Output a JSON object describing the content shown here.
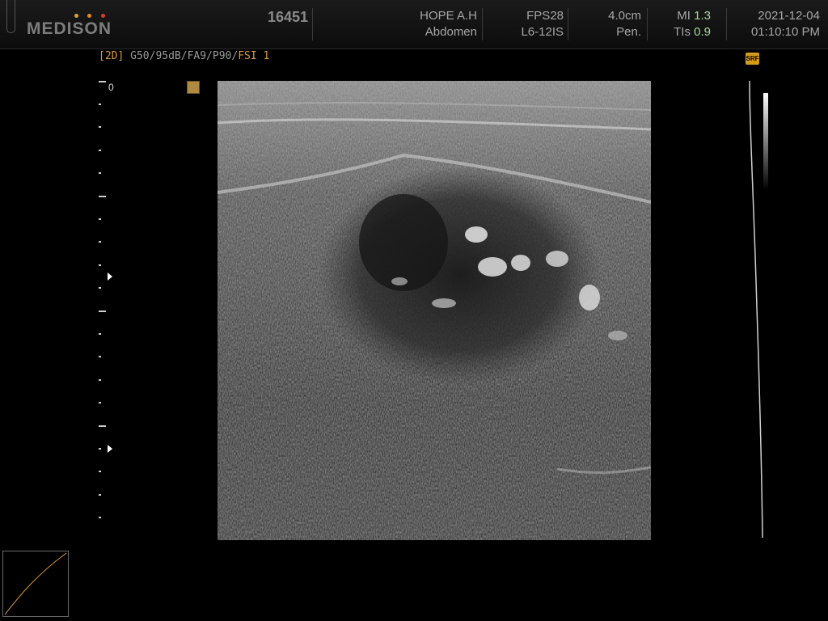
{
  "header": {
    "brand": "MEDISON",
    "patient_id": "16451",
    "patient_name": "HOPE A.H",
    "exam": "Abdomen",
    "fps": "FPS28",
    "probe": "L6-12IS",
    "depth": "4.0cm",
    "preset": "Pen.",
    "mi_label": "MI",
    "mi_value": "1.3",
    "tis_label": "TIs",
    "tis_value": "0.9",
    "date": "2021-12-04",
    "time": "01:10:10 PM"
  },
  "params": {
    "mode": "[2D]",
    "settings": " G50/95dB/FA9/P90/",
    "fsi": "FSI 1"
  },
  "ruler": {
    "zero_label": "0"
  },
  "badges": {
    "srf": "SRF"
  },
  "colors": {
    "brand_dot_1": "#e0a030",
    "brand_dot_2": "#e08a2a",
    "brand_dot_3": "#d63a2a",
    "accent_orange": "#d89a3a",
    "index_green": "#a9d79a"
  }
}
